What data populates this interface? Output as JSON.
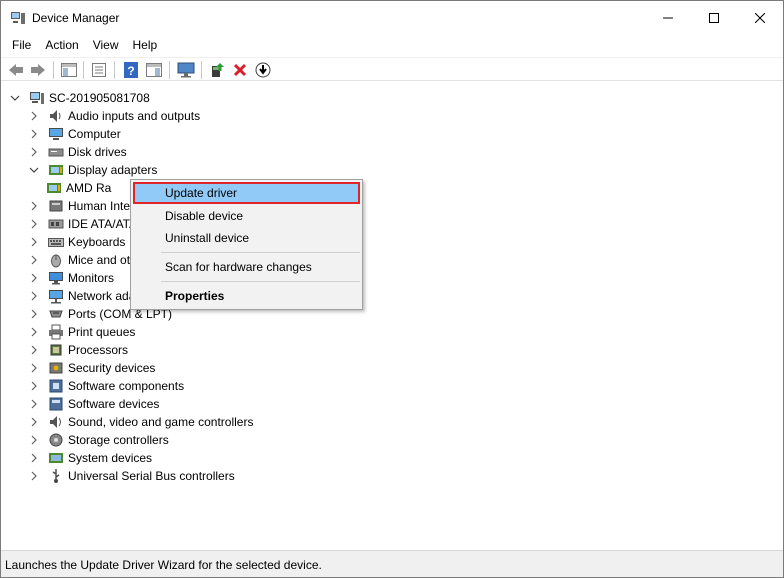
{
  "window": {
    "title": "Device Manager"
  },
  "menubar": [
    "File",
    "Action",
    "View",
    "Help"
  ],
  "toolbar": {
    "icons": [
      "back-arrow-icon",
      "forward-arrow-icon",
      "show-hide-tree-icon",
      "properties-icon",
      "help-icon",
      "action-pane-icon",
      "monitor-icon",
      "update-driver-icon",
      "uninstall-icon",
      "download-icon"
    ]
  },
  "tree": {
    "root": "SC-201905081708",
    "items": [
      {
        "label": "Audio inputs and outputs",
        "icon": "speaker-icon"
      },
      {
        "label": "Computer",
        "icon": "computer-icon"
      },
      {
        "label": "Disk drives",
        "icon": "disk-drive-icon"
      },
      {
        "label": "Display adapters",
        "icon": "display-adapter-icon",
        "expanded": true
      },
      {
        "label": "AMD Ra",
        "icon": "display-adapter-icon",
        "child": true
      },
      {
        "label": "Human Inte",
        "icon": "hid-icon"
      },
      {
        "label": "IDE ATA/ATA",
        "icon": "ide-icon"
      },
      {
        "label": "Keyboards",
        "icon": "keyboard-icon"
      },
      {
        "label": "Mice and ot",
        "icon": "mouse-icon"
      },
      {
        "label": "Monitors",
        "icon": "monitor-icon"
      },
      {
        "label": "Network ada",
        "icon": "network-icon"
      },
      {
        "label": "Ports (COM & LPT)",
        "icon": "port-icon"
      },
      {
        "label": "Print queues",
        "icon": "printer-icon"
      },
      {
        "label": "Processors",
        "icon": "processor-icon"
      },
      {
        "label": "Security devices",
        "icon": "security-icon"
      },
      {
        "label": "Software components",
        "icon": "software-component-icon"
      },
      {
        "label": "Software devices",
        "icon": "software-device-icon"
      },
      {
        "label": "Sound, video and game controllers",
        "icon": "sound-icon"
      },
      {
        "label": "Storage controllers",
        "icon": "storage-icon"
      },
      {
        "label": "System devices",
        "icon": "system-icon"
      },
      {
        "label": "Universal Serial Bus controllers",
        "icon": "usb-icon"
      }
    ]
  },
  "context_menu": {
    "items": [
      "Update driver",
      "Disable device",
      "Uninstall device",
      "Scan for hardware changes",
      "Properties"
    ],
    "highlighted": "Update driver",
    "highlight_color": "#91c9f7",
    "annotation_border_color": "#e0252a"
  },
  "status": {
    "text": "Launches the Update Driver Wizard for the selected device."
  }
}
